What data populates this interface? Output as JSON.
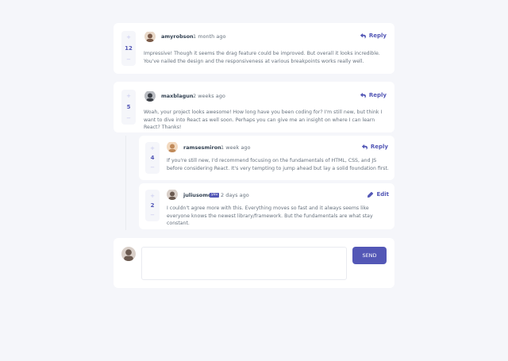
{
  "comments": [
    {
      "user": "amyrobson",
      "created": "1 month ago",
      "score": "12",
      "action": "Reply",
      "content": "Impressive! Though it seems the drag feature could be improved. But overall it looks incredible. You've nailed the design and the responsiveness at various breakpoints works really well.",
      "avatar_color": "#7a5a48"
    },
    {
      "user": "maxblagun",
      "created": "2 weeks ago",
      "score": "5",
      "action": "Reply",
      "content": "Woah, your project looks awesome! How long have you been coding for? I'm still new, but think I want to dive into React as well soon. Perhaps you can give me an insight on where I can learn React? Thanks!",
      "avatar_color": "#3b3f46"
    }
  ],
  "replies": [
    {
      "user": "ramsesmiron",
      "created": "1 week ago",
      "score": "4",
      "action": "Reply",
      "content": "If you're still new, I'd recommend focusing on the fundamentals of HTML, CSS, and JS before considering React. It's very tempting to jump ahead but lay a solid foundation first.",
      "avatar_color": "#c08a5a"
    },
    {
      "user": "juliusomo",
      "you": "you",
      "created": "2 days ago",
      "score": "2",
      "action": "Edit",
      "content": "I couldn't agree more with this. Everything moves so fast and it always seems like everyone knows the newest library/framework. But the fundamentals are what stay constant.",
      "avatar_color": "#6b5a50"
    }
  ],
  "vote": {
    "plus": "+",
    "minus": "−"
  },
  "composer": {
    "send_label": "SEND",
    "placeholder": "",
    "avatar_color": "#6b5a50"
  },
  "colors": {
    "accent": "#5357b6",
    "accent_light": "#c5c6ef",
    "text_dark": "#334253",
    "text": "#67727e",
    "bg": "#f5f6fa"
  }
}
